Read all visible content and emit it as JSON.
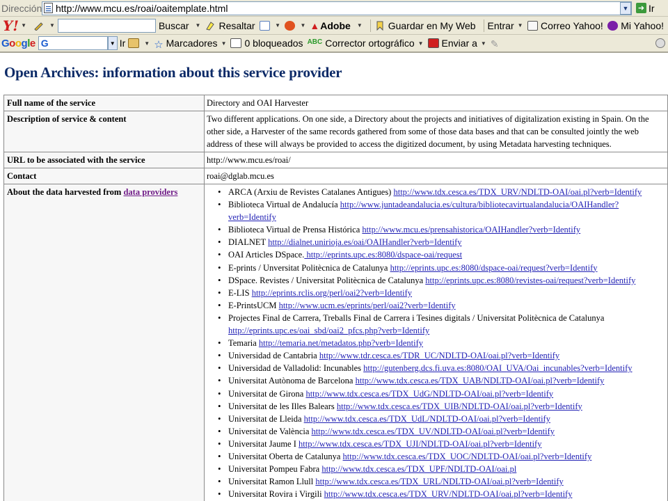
{
  "browser": {
    "address_label": "Dirección",
    "url": "http://www.mcu.es/roai/oaitemplate.html",
    "go_label": "Ir"
  },
  "yahoo_toolbar": {
    "logo": "Y!",
    "search_button": "Buscar",
    "highlight": "Resaltar",
    "adobe": "Adobe",
    "save_myweb": "Guardar en My Web",
    "enter": "Entrar",
    "mail": "Correo Yahoo!",
    "my_yahoo": "Mi Yahoo!"
  },
  "google_toolbar": {
    "logo": "Google",
    "search_value": "G",
    "go_label": "Ir",
    "bookmarks": "Marcadores",
    "blocked": "0 bloqueados",
    "spellcheck": "Corrector ortográfico",
    "send_to": "Enviar a"
  },
  "page": {
    "title": "Open Archives: information about this service provider",
    "rows": {
      "name_label": "Full name of the service",
      "name_value": "Directory and OAI Harvester",
      "desc_label": "Description of service & content",
      "desc_value": "Two different applications. On one side, a Directory about the projects and initiatives of digitalization existing in Spain. On the other side, a Harvester of the same records gathered from some of those data bases and that can be consulted jointly the web address of these will always be provided to access the digitized document, by using Metadata harvesting techniques.",
      "url_label": "URL to be associated with the service",
      "url_value": "http://www.mcu.es/roai/",
      "contact_label": "Contact",
      "contact_value": "roai@dglab.mcu.es",
      "about_label": "About the data harvested from ",
      "about_link": "data providers"
    },
    "providers": [
      {
        "name": "ARCA (Arxiu de Revistes Catalanes Antigues) ",
        "url": "http://www.tdx.cesca.es/TDX_URV/NDLTD-OAI/oai.pl?verb=Identify"
      },
      {
        "name": "Biblioteca Virtual de Andalucía ",
        "url": "http://www.juntadeandalucia.es/cultura/bibliotecavirtualandalucia/OAIHandler?verb=Identify"
      },
      {
        "name": "Biblioteca Virtual de Prensa Histórica ",
        "url": "http://www.mcu.es/prensahistorica/OAIHandler?verb=Identify"
      },
      {
        "name": "DIALNET ",
        "url": "http://dialnet.unirioja.es/oai/OAIHandler?verb=Identify"
      },
      {
        "name": "OAI Articles DSpace.",
        "url": " http://eprints.upc.es:8080/dspace-oai/request"
      },
      {
        "name": "E-prints / Unversitat Politècnica de Catalunya ",
        "url": "http://eprints.upc.es:8080/dspace-oai/request?verb=Identify"
      },
      {
        "name": "DSpace. Revistes / Universitat Politècnica de Catalunya ",
        "url": "http://eprints.upc.es:8080/revistes-oai/request?verb=Identify"
      },
      {
        "name": "E-LIS ",
        "url": "http://eprints.rclis.org/perl/oai2?verb=Identify"
      },
      {
        "name": "E-PrintsUCM ",
        "url": "http://www.ucm.es/eprints/perl/oai2?verb=Identify"
      },
      {
        "name": "Projectes Final de Carrera, Treballs Final de Carrera i Tesines digitals / Universitat Politècnica de Catalunya ",
        "url": "http://eprints.upc.es/oai_sbd/oai2_pfcs.php?verb=Identify"
      },
      {
        "name": "Temaria ",
        "url": "http://temaria.net/metadatos.php?verb=Identify"
      },
      {
        "name": "Universidad de Cantabria ",
        "url": "http://www.tdr.cesca.es/TDR_UC/NDLTD-OAI/oai.pl?verb=Identify"
      },
      {
        "name": "Universidad de Valladolid: Incunables ",
        "url": "http://gutenberg.dcs.fi.uva.es:8080/OAI_UVA/Oai_incunables?verb=Identify"
      },
      {
        "name": "Universitat Autònoma de Barcelona ",
        "url": "http://www.tdx.cesca.es/TDX_UAB/NDLTD-OAI/oai.pl?verb=Identify"
      },
      {
        "name": "Universitat de Girona ",
        "url": "http://www.tdx.cesca.es/TDX_UdG/NDLTD-OAI/oai.pl?verb=Identify"
      },
      {
        "name": "Universitat de les Illes Balears ",
        "url": "http://www.tdx.cesca.es/TDX_UIB/NDLTD-OAI/oai.pl?verb=Identify"
      },
      {
        "name": "Universitat de Lleida ",
        "url": "http://www.tdx.cesca.es/TDX_UdL/NDLTD-OAI/oai.pl?verb=Identify"
      },
      {
        "name": "Universitat de València ",
        "url": "http://www.tdx.cesca.es/TDX_UV/NDLTD-OAI/oai.pl?verb=Identify"
      },
      {
        "name": "Universitat Jaume I ",
        "url": "http://www.tdx.cesca.es/TDX_UJI/NDLTD-OAI/oai.pl?verb=Identify"
      },
      {
        "name": "Universitat Oberta de Catalunya ",
        "url": "http://www.tdx.cesca.es/TDX_UOC/NDLTD-OAI/oai.pl?verb=Identify"
      },
      {
        "name": "Universitat Pompeu Fabra ",
        "url": "http://www.tdx.cesca.es/TDX_UPF/NDLTD-OAI/oai.pl"
      },
      {
        "name": "Universitat Ramon Llull ",
        "url": "http://www.tdx.cesca.es/TDX_URL/NDLTD-OAI/oai.pl?verb=Identify"
      },
      {
        "name": "Universitat Rovira i Virgili ",
        "url": "http://www.tdx.cesca.es/TDX_URV/NDLTD-OAI/oai.pl?verb=Identify"
      }
    ]
  }
}
